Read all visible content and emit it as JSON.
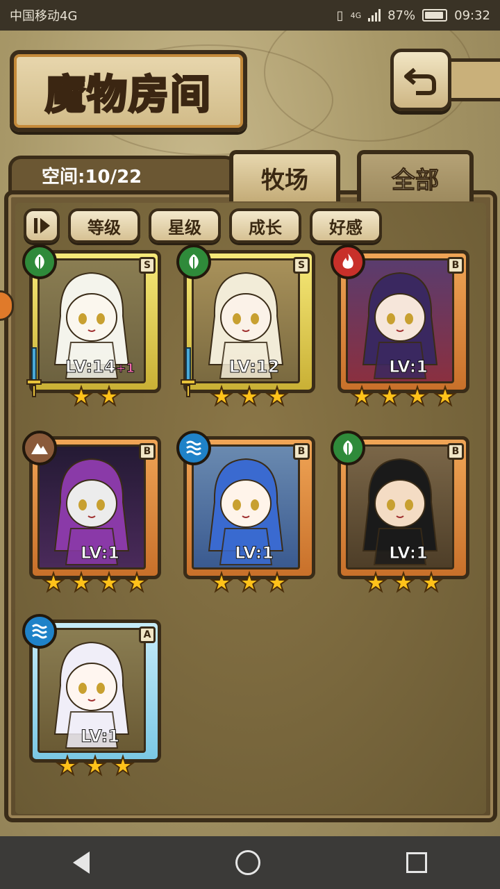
{
  "status_bar": {
    "carrier": "中国移动4G",
    "network": "4G",
    "battery": "87%",
    "time": "09:32"
  },
  "header": {
    "title": "魔物房间"
  },
  "storage": {
    "label": "空间:10/22"
  },
  "tabs": [
    {
      "label": "牧场",
      "active": true
    },
    {
      "label": "全部",
      "active": false
    }
  ],
  "filters": [
    "等级",
    "星级",
    "成长",
    "好感"
  ],
  "monsters": [
    {
      "level": "LV:14",
      "level_bonus": "+1",
      "rank": "S",
      "stars": 2,
      "element": "grass",
      "frame": "gold",
      "equipped": true
    },
    {
      "level": "LV:12",
      "level_bonus": "",
      "rank": "S",
      "stars": 3,
      "element": "grass",
      "frame": "gold",
      "equipped": true
    },
    {
      "level": "LV:1",
      "level_bonus": "",
      "rank": "B",
      "stars": 4,
      "element": "fire",
      "frame": "orange",
      "equipped": false
    },
    {
      "level": "LV:1",
      "level_bonus": "",
      "rank": "B",
      "stars": 4,
      "element": "earth",
      "frame": "orange",
      "equipped": false
    },
    {
      "level": "LV:1",
      "level_bonus": "",
      "rank": "B",
      "stars": 3,
      "element": "water",
      "frame": "orange",
      "equipped": false
    },
    {
      "level": "LV:1",
      "level_bonus": "",
      "rank": "B",
      "stars": 3,
      "element": "grass",
      "frame": "orange",
      "equipped": false
    },
    {
      "level": "LV:1",
      "level_bonus": "",
      "rank": "A",
      "stars": 3,
      "element": "water",
      "frame": "blue",
      "equipped": false
    }
  ],
  "colors": {
    "grass": "#2f8a3a",
    "fire": "#c8302a",
    "earth": "#8a5a3a",
    "water": "#1f82c8",
    "star": "#ffc21a"
  },
  "icons": {
    "back_button": "return-arrow-icon",
    "grass": "leaf-icon",
    "fire": "flame-icon",
    "earth": "mountain-icon",
    "water": "wave-icon"
  }
}
